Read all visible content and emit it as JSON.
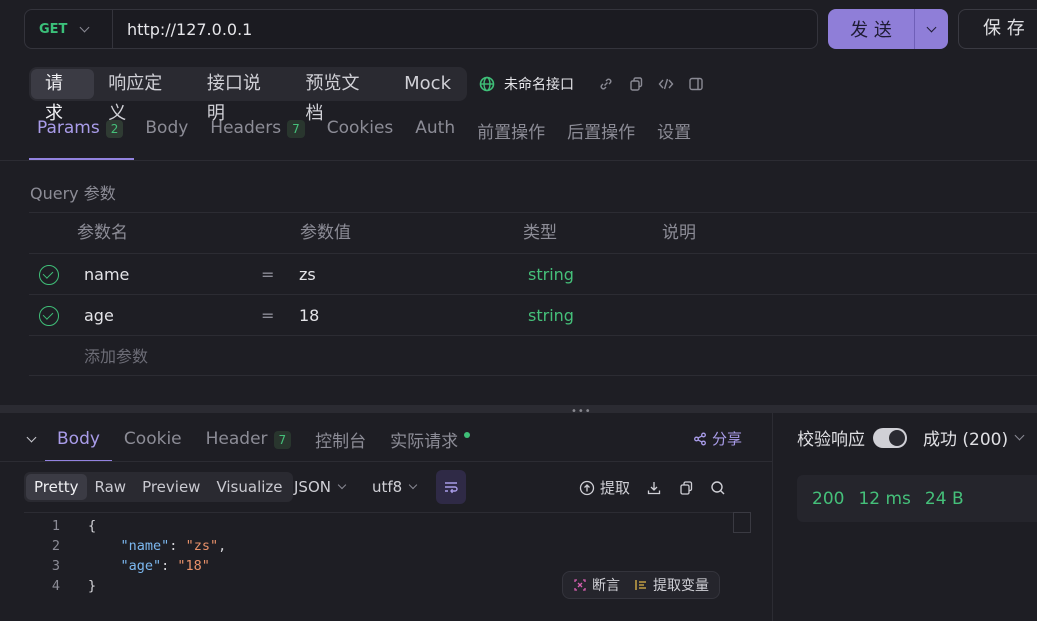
{
  "request": {
    "method": "GET",
    "url": "http://127.0.0.1",
    "send_label": "发 送",
    "save_label": "保 存"
  },
  "top_tabs": [
    "请求",
    "响应定义",
    "接口说明",
    "预览文档",
    "Mock"
  ],
  "api_name": "未命名接口",
  "param_tabs": [
    {
      "label": "Params",
      "badge": "2"
    },
    {
      "label": "Body",
      "badge": ""
    },
    {
      "label": "Headers",
      "badge": "7"
    },
    {
      "label": "Cookies",
      "badge": ""
    },
    {
      "label": "Auth",
      "badge": ""
    },
    {
      "label": "前置操作",
      "badge": ""
    },
    {
      "label": "后置操作",
      "badge": ""
    },
    {
      "label": "设置",
      "badge": ""
    }
  ],
  "query_title": "Query 参数",
  "table": {
    "headers": [
      "参数名",
      "参数值",
      "类型",
      "说明"
    ],
    "rows": [
      {
        "name": "name",
        "eq": "=",
        "value": "zs",
        "type": "string"
      },
      {
        "name": "age",
        "eq": "=",
        "value": "18",
        "type": "string"
      }
    ],
    "add_label": "添加参数"
  },
  "response": {
    "tabs": [
      {
        "label": "Body",
        "badge": ""
      },
      {
        "label": "Cookie",
        "badge": ""
      },
      {
        "label": "Header",
        "badge": "7"
      },
      {
        "label": "控制台",
        "badge": ""
      },
      {
        "label": "实际请求",
        "badge": ""
      }
    ],
    "share_label": "分享",
    "validate_label": "校验响应",
    "status_select": "成功 (200)",
    "stats": {
      "code": "200",
      "time": "12 ms",
      "size": "24 B"
    },
    "formats": [
      "Pretty",
      "Raw",
      "Preview",
      "Visualize"
    ],
    "lang": "JSON",
    "encoding": "utf8",
    "extract_label": "提取",
    "code_lines": [
      "{",
      "    \"name\": \"zs\",",
      "    \"age\": \"18\"",
      "}"
    ],
    "assert_label": "断言",
    "extract_var_label": "提取变量"
  },
  "colors": {
    "accent": "#9383e0",
    "success": "#45c07a",
    "method": "#3bc07a"
  }
}
